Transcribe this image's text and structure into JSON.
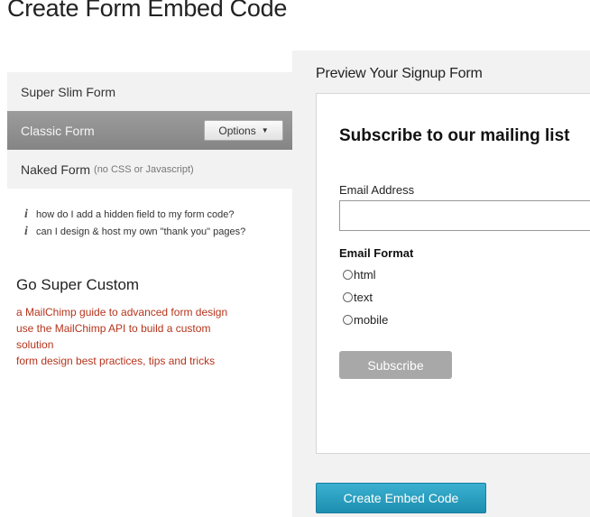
{
  "page": {
    "title": "Create Form Embed Code"
  },
  "form_types": {
    "items": [
      {
        "label": "Super Slim Form",
        "note": ""
      },
      {
        "label": "Classic Form",
        "note": "",
        "selected": true
      },
      {
        "label": "Naked Form",
        "note": "(no CSS or Javascript)"
      }
    ],
    "options_label": "Options",
    "options_caret": "▼"
  },
  "help_links": [
    {
      "icon": "info-icon",
      "glyph": "i",
      "text": "how do I add a hidden field to my form code?"
    },
    {
      "icon": "info-icon",
      "glyph": "i",
      "text": "can I design & host my own \"thank you\" pages?"
    }
  ],
  "super_custom": {
    "heading": "Go Super Custom",
    "links": [
      "a MailChimp guide to advanced form design",
      "use the MailChimp API to build a custom solution",
      "form design best practices, tips and tricks"
    ]
  },
  "preview": {
    "title": "Preview Your Signup Form",
    "heading": "Subscribe to our mailing list",
    "email_label": "Email Address",
    "email_value": "",
    "format_label": "Email Format",
    "formats": [
      "html",
      "text",
      "mobile"
    ],
    "subscribe_label": "Subscribe"
  },
  "actions": {
    "create_label": "Create Embed Code"
  },
  "colors": {
    "link": "#b5341c",
    "selected_bg": "#8f8f8f",
    "subscribe_bg": "#a8a8a8",
    "create_bg": "#2a9fc2"
  }
}
